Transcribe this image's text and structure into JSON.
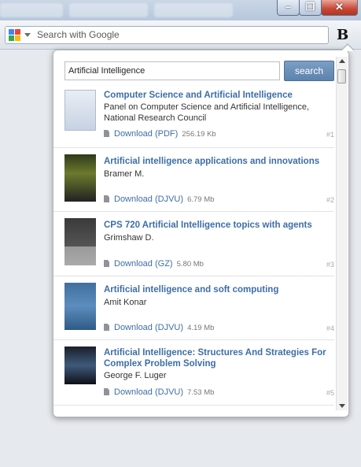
{
  "toolbar": {
    "search_placeholder": "Search with Google",
    "b_button_label": "B"
  },
  "popup": {
    "query_value": "Artificial Intelligence",
    "search_label": "search",
    "results": [
      {
        "title": "Computer Science and Artificial Intelligence",
        "author": "Panel on Computer Science and Artificial Intelligence, National Research Council",
        "download_label": "Download (PDF)",
        "size": "256.19 Kb",
        "rank": "#1"
      },
      {
        "title": "Artificial intelligence applications and innovations",
        "author": "Bramer M.",
        "download_label": "Download (DJVU)",
        "size": "6.79 Mb",
        "rank": "#2"
      },
      {
        "title": "CPS 720 Artificial Intelligence topics with agents",
        "author": "Grimshaw D.",
        "download_label": "Download (GZ)",
        "size": "5.80 Mb",
        "rank": "#3"
      },
      {
        "title": "Artificial intelligence and soft computing",
        "author": "Amit Konar",
        "download_label": "Download (DJVU)",
        "size": "4.19 Mb",
        "rank": "#4"
      },
      {
        "title": "Artificial Intelligence: Structures And Strategies For Complex Problem Solving",
        "author": "George F. Luger",
        "download_label": "Download (DJVU)",
        "size": "7.53 Mb",
        "rank": "#5"
      }
    ]
  }
}
